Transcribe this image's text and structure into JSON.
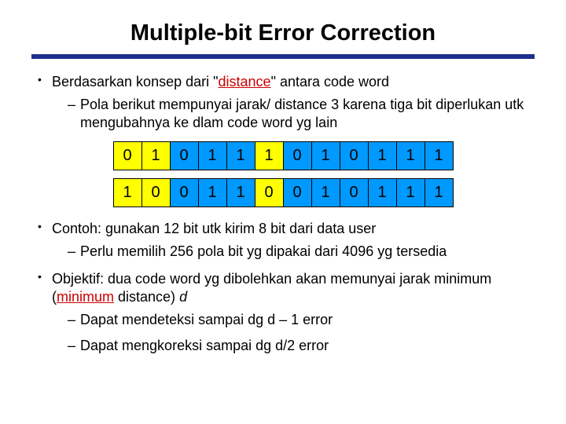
{
  "title": "Multiple-bit Error Correction",
  "bullets": {
    "b1_pre": "Berdasarkan konsep dari \"",
    "b1_distance": "distance",
    "b1_post": "\" antara code word",
    "b1_sub1": "Pola berikut mempunyai jarak/ distance 3 karena tiga bit diperlukan utk mengubahnya ke dlam code word yg lain",
    "b2": "Contoh: gunakan 12 bit utk kirim 8 bit dari data user",
    "b2_sub1": "Perlu memilih 256 pola bit yg dipakai dari 4096 yg tersedia",
    "b3_pre": "Objektif:  dua code word yg dibolehkan akan memunyai jarak minimum (",
    "b3_min": "minimum",
    "b3_mid": " distance) ",
    "b3_d": "d",
    "b3_sub1": "Dapat mendeteksi sampai dg d – 1 error",
    "b3_sub2": "Dapat mengkoreksi sampai dg d/2 error"
  },
  "chart_data": {
    "type": "table",
    "title": "Two 12-bit code words with Hamming distance 3",
    "rows": [
      {
        "bits": [
          0,
          1,
          0,
          1,
          1,
          1,
          0,
          1,
          0,
          1,
          1,
          1
        ]
      },
      {
        "bits": [
          1,
          0,
          0,
          1,
          1,
          0,
          0,
          1,
          0,
          1,
          1,
          1
        ]
      }
    ],
    "diff_positions": [
      0,
      1,
      5
    ],
    "colors": {
      "diff": "#ffff00",
      "same": "#0099ff"
    }
  }
}
